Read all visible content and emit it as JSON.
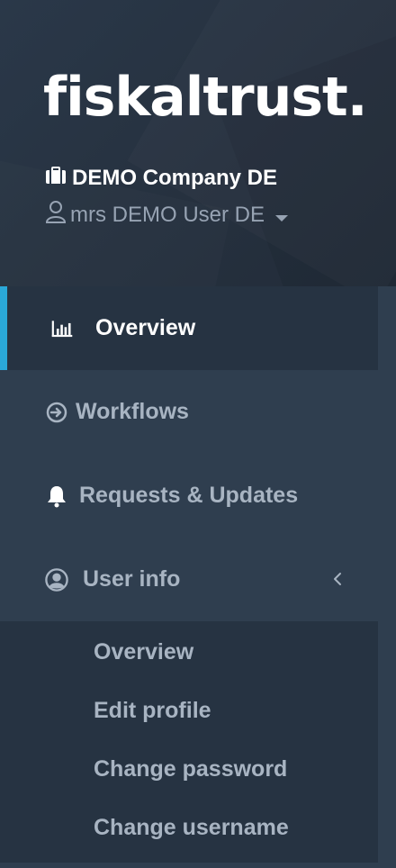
{
  "brand": {
    "logo_text": "fiskaltrust."
  },
  "account": {
    "company_name": "DEMO Company DE",
    "user_name": "mrs DEMO User DE"
  },
  "nav": {
    "items": [
      {
        "label": "Overview",
        "icon": "bar-chart-icon",
        "active": true
      },
      {
        "label": "Workflows",
        "icon": "arrow-circle-right-icon"
      },
      {
        "label": "Requests & Updates",
        "icon": "bell-icon"
      },
      {
        "label": "User info",
        "icon": "user-circle-icon",
        "expanded": true
      }
    ],
    "user_info_submenu": [
      {
        "label": "Overview"
      },
      {
        "label": "Edit profile"
      },
      {
        "label": "Change password"
      },
      {
        "label": "Change username"
      }
    ]
  },
  "colors": {
    "accent": "#2aa8d8",
    "sidebar_bg": "#2f3e4f",
    "active_bg": "#263342",
    "text_muted": "#a8b4c2"
  }
}
